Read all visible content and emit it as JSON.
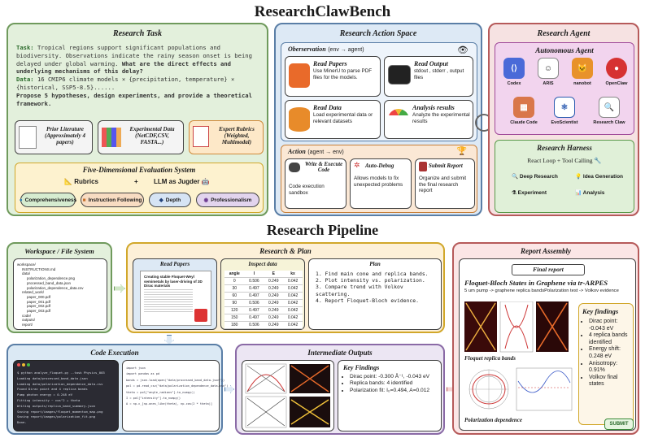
{
  "header": {
    "title": "ResearchClawBench"
  },
  "pipeline_title": "Research Pipeline",
  "research_task": {
    "title": "Research Task",
    "task_label": "Task:",
    "task_text": "Tropical regions support significant populations and biodiversity. Observations indicate the rainy season onset is being delayed under global warming.",
    "task_question": "What are the direct effects and underlying mechanisms of this delay?",
    "data_label": "Data:",
    "data_text": "16 CMIP6 climate models × {precipitation, temperature} × {historical, SSP5-8.5}......",
    "propose_text": "Propose 5 hypotheses, design experiments, and provide a theoretical framework.",
    "prior_lit": "Prior Literature (Approximately 4 papers)",
    "exp_data": "Experimental Data (NetCDF,CSV, FASTA...)",
    "rubrics": "Expert Rubrics (Weighted, Multimodal)"
  },
  "eval_system": {
    "title": "Five-Dimensional Evaluation System",
    "rubrics": "Rubrics",
    "llm_judge": "LLM as Jugder",
    "dims": [
      "Comprehensiveness",
      "Instruction Following",
      "Depth",
      "Professionalism"
    ]
  },
  "action_space": {
    "title": "Research Action Space",
    "observation": "Oberservation",
    "obs_arrow": "(env → agent)",
    "read_papers": {
      "title": "Read Papers",
      "desc": "Use MinerU to parse PDF files for the models."
    },
    "read_output": {
      "title": "Read Output",
      "desc": "stdout , stderr , output files"
    },
    "read_data": {
      "title": "Read Data",
      "desc": "Load experimental data or relevant datasets"
    },
    "analysis": {
      "title": "Analysis results",
      "desc": "Analyze the experimental results"
    },
    "action": "Action",
    "act_arrow": "(agent → env)",
    "write": {
      "title": "Write & Execute Code",
      "desc": "Code execution sandbox"
    },
    "debug": {
      "title": "Auto-Debug",
      "desc": "Allows models to fix unexpected problems"
    },
    "submit": {
      "title": "Submit Report",
      "desc": "Organize and submit the final research report"
    }
  },
  "research_agent": {
    "title": "Research Agent",
    "autonomous": "Autonomous Agent",
    "agents": [
      "Codex",
      "ARIS",
      "nanobot",
      "OpenClaw",
      "Claude Code",
      "EvoScientist",
      "Research Claw"
    ],
    "harness_title": "Research Harness",
    "harness_sub": "React Loop + Tool Calling",
    "harness_items": [
      "Deep Research",
      "Idea Generation",
      "Experiment",
      "Analysis"
    ]
  },
  "workspace": {
    "title": "Workspace / File System",
    "files": [
      "workspace/",
      "INSTRUCTIONS.md",
      "data/",
      "polarization_dependence.png",
      "processed_band_data.json",
      "polarization_dependence_data.csv",
      "related_work/",
      "paper_000.pdf",
      "paper_001.pdf",
      "paper_002.pdf",
      "paper_003.pdf",
      "code/",
      "outputs/",
      "report/"
    ]
  },
  "research_plan": {
    "title": "Research & Plan",
    "read_papers": "Read Papers",
    "paper_heading": "Creating stable Floquet-Weyl semimetals by laser-driving of 3D Dirac materials",
    "inspect": "Inspect data",
    "table_head": [
      "angle",
      "I",
      "E",
      "kx"
    ],
    "table_rows": [
      [
        "0",
        "0.506",
        "0.249",
        "0.042"
      ],
      [
        "30",
        "0.497",
        "0.249",
        "0.042"
      ],
      [
        "60",
        "0.497",
        "0.249",
        "0.042"
      ],
      [
        "90",
        "0.506",
        "0.249",
        "0.042"
      ],
      [
        "120",
        "0.497",
        "0.249",
        "0.042"
      ],
      [
        "150",
        "0.497",
        "0.249",
        "0.042"
      ],
      [
        "180",
        "0.506",
        "0.249",
        "0.042"
      ]
    ],
    "plan_title": "Plan",
    "plan_steps": [
      "1. Find main cone and replica bands.",
      "2. Plot intensity vs. polarization.",
      "3. Compare trend with Volkov scattering.",
      "4. Report Floquet-Bloch evidence."
    ]
  },
  "code_execution": {
    "title": "Code Execution",
    "term_lines": [
      "$ python analyze_floquet.py --task Physics_003",
      "Loading data/processed_band_data.json",
      "Loading data/polarization_dependence_data.csv",
      "Found Dirac point and 4 replica bands",
      "Pump photon energy = 0.248 eV",
      "Fitting intensity ~ cos^2 + theta",
      "Writing outputs/replica_band_summary.json",
      "Saving report/images/floquet_momentum_map.png",
      "Saving report/images/polarization_fit.png",
      "Done."
    ],
    "code_lines": [
      "import json",
      "import pandas as pd",
      "",
      "bands = json.load(open(\"data/processed_band_data.json\"))",
      "pol = pd.read_csv(\"data/polarization_dependence_data.csv\")",
      "",
      "theta = pol[\"angle_radians\"].to_numpy()",
      "I = pol[\"intensity\"].to_numpy()",
      "",
      "A = np.c_[np.ones_like(theta), np.cos(2 * theta)]"
    ]
  },
  "intermediate": {
    "title": "Intermediate Outputs",
    "kf_title": "Key Findings",
    "kf_items": [
      "Dirac point: -0.300 Å⁻¹, -0.043 eV",
      "Replica bands: 4 identified",
      "Polarization fit: I₀=0.494, A=0.012"
    ]
  },
  "report": {
    "title": "Report Assembly",
    "final": "Final report",
    "headline": "Floquet-Bloch States in Graphene via tr-ARPES",
    "subline": "5 um pump -> graphene replica bandsPolarization test -> Volkov evidence",
    "fig1": "Floquet replica bands",
    "fig2": "Polarization dependence",
    "kf_title": "Key findings",
    "kf_items": [
      "Dirac point: -0.043 eV",
      "4 replica bands identified",
      "Energy shift: 0.248 eV",
      "Anisotropy: 0.91%",
      "Volkov final states"
    ],
    "submit": "SUBMIT"
  },
  "colors": {
    "task_bg": "#e3f0dc",
    "action_bg": "#dde9f5",
    "agent_bg": "#f6e2e2",
    "eval_bg": "#fdf2cf",
    "plan_bg": "#fdf0d8",
    "code_bg": "#dbe9f4",
    "inter_bg": "#ece6f3",
    "report_bg": "#fbe6e6"
  }
}
